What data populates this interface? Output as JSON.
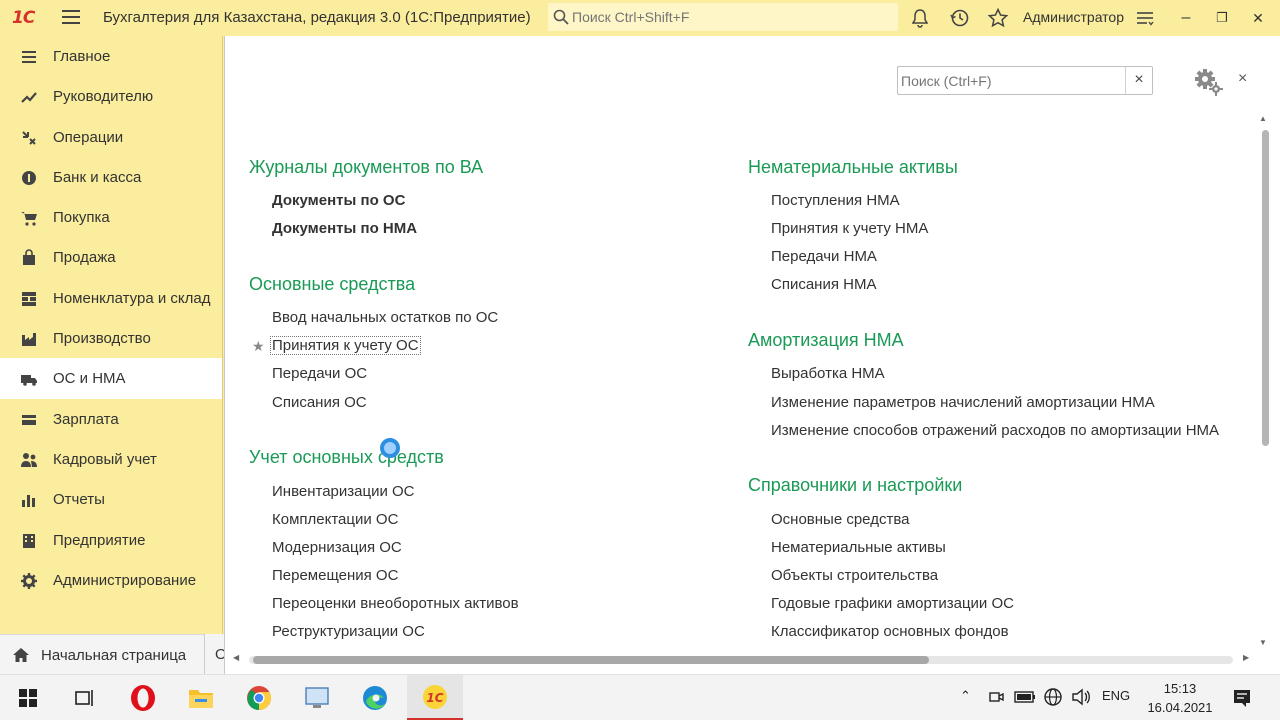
{
  "titlebar": {
    "logo_text": "1С",
    "title": "Бухгалтерия для Казахстана, редакция 3.0  (1С:Предприятие)",
    "search_placeholder": "Поиск Ctrl+Shift+F",
    "user": "Администратор",
    "minimize": "–",
    "restore": "❐",
    "close": "✕"
  },
  "sidebar": {
    "items": [
      {
        "label": "Главное",
        "icon": "list-icon"
      },
      {
        "label": "Руководителю",
        "icon": "trend-icon"
      },
      {
        "label": "Операции",
        "icon": "operations-icon"
      },
      {
        "label": "Банк и касса",
        "icon": "coin-icon"
      },
      {
        "label": "Покупка",
        "icon": "cart-icon"
      },
      {
        "label": "Продажа",
        "icon": "bag-icon"
      },
      {
        "label": "Номенклатура и склад",
        "icon": "grid-icon"
      },
      {
        "label": "Производство",
        "icon": "factory-icon"
      },
      {
        "label": "ОС и НМА",
        "icon": "truck-icon"
      },
      {
        "label": "Зарплата",
        "icon": "wallet-icon"
      },
      {
        "label": "Кадровый учет",
        "icon": "people-icon"
      },
      {
        "label": "Отчеты",
        "icon": "bar-chart-icon"
      },
      {
        "label": "Предприятие",
        "icon": "building-icon"
      },
      {
        "label": "Администрирование",
        "icon": "gear-icon"
      }
    ],
    "active_index": 8
  },
  "bottom_tabs": {
    "home": "Начальная страница",
    "second": "О"
  },
  "panel": {
    "search_placeholder": "Поиск (Ctrl+F)",
    "clear": "×",
    "close": "×",
    "left_sections": [
      {
        "title": "Журналы документов по ВА",
        "links": [
          "Документы по ОС",
          "Документы по НМА"
        ]
      },
      {
        "title": "Основные средства",
        "links": [
          "Ввод начальных остатков по ОС",
          "Принятия к учету ОС",
          "Передачи ОС",
          "Списания ОС"
        ]
      },
      {
        "title": "Учет основных средств",
        "links": [
          "Инвентаризации ОС",
          "Комплектации ОС",
          "Модернизация ОС",
          "Перемещения ОС",
          "Переоценки внеоборотных активов",
          "Реструктуризации ОС"
        ]
      }
    ],
    "right_sections": [
      {
        "title": "Нематериальные активы",
        "links": [
          "Поступления НМА",
          "Принятия к учету НМА",
          "Передачи НМА",
          "Списания НМА"
        ]
      },
      {
        "title": "Амортизация НМА",
        "links": [
          "Выработка НМА",
          "Изменение параметров начислений амортизации НМА",
          "Изменение способов отражений расходов по амортизации НМА"
        ]
      },
      {
        "title": "Справочники и настройки",
        "links": [
          "Основные средства",
          "Нематериальные активы",
          "Объекты строительства",
          "Годовые графики амортизации ОС",
          "Классификатор основных фондов"
        ]
      }
    ]
  },
  "taskbar": {
    "lang": "ENG",
    "time": "15:13",
    "date": "16.04.2021"
  }
}
